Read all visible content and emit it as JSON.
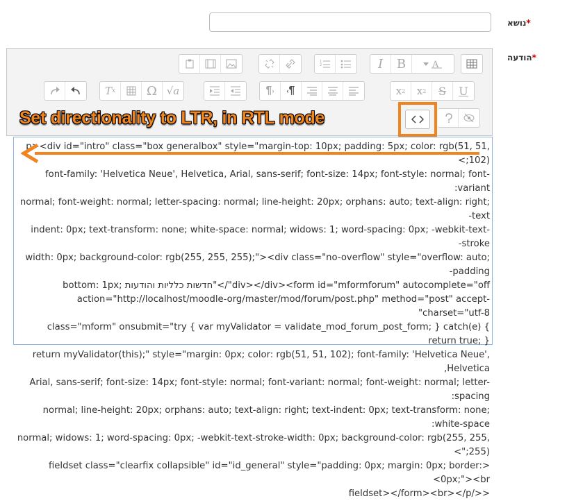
{
  "subject": {
    "label": "נושא",
    "required_mark": "*",
    "value": ""
  },
  "message": {
    "label": "הודעה",
    "required_mark": "*"
  },
  "toolbar": {
    "row1": [
      {
        "name": "paste-icon",
        "glyph": "📋"
      },
      {
        "name": "media-icon",
        "glyph": "🎞"
      },
      {
        "name": "image-icon",
        "glyph": "🖼"
      },
      {
        "name": "unlink-icon",
        "glyph": "⛓"
      },
      {
        "name": "link-icon",
        "glyph": "🔗"
      },
      {
        "name": "ordered-list-icon",
        "glyph": "≡"
      },
      {
        "name": "unordered-list-icon",
        "glyph": "☰"
      },
      {
        "name": "italic-icon",
        "glyph": "I"
      },
      {
        "name": "bold-icon",
        "glyph": "B"
      },
      {
        "name": "font-color-icon",
        "glyph": "A"
      },
      {
        "name": "toolbar-toggle-icon",
        "glyph": "▤"
      }
    ],
    "row2": [
      {
        "name": "redo-icon",
        "glyph": "↷"
      },
      {
        "name": "undo-icon",
        "glyph": "↶"
      },
      {
        "name": "clear-format-icon",
        "glyph": "Tx"
      },
      {
        "name": "table-icon",
        "glyph": "▦"
      },
      {
        "name": "special-char-icon",
        "glyph": "Ω"
      },
      {
        "name": "equation-icon",
        "glyph": "√a"
      },
      {
        "name": "indent-icon",
        "glyph": "⇥"
      },
      {
        "name": "outdent-icon",
        "glyph": "⇤"
      },
      {
        "name": "ltr-icon",
        "glyph": "¶"
      },
      {
        "name": "rtl-icon",
        "glyph": "¶"
      },
      {
        "name": "align-right-icon",
        "glyph": "≡"
      },
      {
        "name": "align-center-icon",
        "glyph": "≡"
      },
      {
        "name": "align-left-icon",
        "glyph": "≡"
      },
      {
        "name": "superscript-icon",
        "glyph": "x²"
      },
      {
        "name": "subscript-icon",
        "glyph": "x₂"
      },
      {
        "name": "strikethrough-icon",
        "glyph": "S"
      },
      {
        "name": "underline-icon",
        "glyph": "U"
      }
    ],
    "row3": [
      {
        "name": "source-code-icon",
        "glyph": "<>"
      },
      {
        "name": "accessibility-checker-icon",
        "glyph": "?"
      },
      {
        "name": "screenreader-helper-icon",
        "glyph": "◎"
      }
    ]
  },
  "annotation": {
    "text": "Set directionality to LTR, in RTL mode",
    "accent": "#f0841e"
  },
  "source": {
    "lines": [
      "p><div id=\"intro\" class=\"box generalbox\" style=\"margin-top: 10px; padding: 5px; color: rgb(51, 51, 102);>",
      "font-family: 'Helvetica Neue', Helvetica, Arial, sans-serif; font-size: 14px; font-style: normal; font-variant:",
      "normal; font-weight: normal; letter-spacing: normal; line-height: 20px; orphans: auto; text-align: right; text-",
      "indent: 0px; text-transform: none; white-space: normal; widows: 1; word-spacing: 0px; -webkit-text-stroke-",
      "width: 0px; background-color: rgb(255, 255, 255);\"><div class=\"no-overflow\" style=\"overflow: auto; padding-",
      "div></div><form id=\"mformforum\" autocomplete=\"off\"/>\"חדשות כלליות והודעות ;bottom: 1px",
      "action=\"http://localhost/moodle-org/master/mod/forum/post.php\" method=\"post\" accept-charset=\"utf-8\"",
      "class=\"mform\" onsubmit=\"try { var myValidator = validate_mod_forum_post_form; } catch(e) { return true; }",
      "return myValidator(this);\" style=\"margin: 0px; color: rgb(51, 51, 102); font-family: 'Helvetica Neue', Helvetica,",
      "Arial, sans-serif; font-size: 14px; font-style: normal; font-variant: normal; font-weight: normal; letter-spacing:",
      "normal; line-height: 20px; orphans: auto; text-align: right; text-indent: 0px; text-transform: none; white-space:",
      "normal; widows: 1; word-spacing: 0px; -webkit-text-stroke-width: 0px; background-color: rgb(255, 255, 255);\">",
      "<fieldset class=\"clearfix collapsible\" id=\"id_general\" style=\"padding: 0px; margin: 0px; border: 0px;\"><br>",
      "<</fieldset></form><br></p"
    ]
  }
}
